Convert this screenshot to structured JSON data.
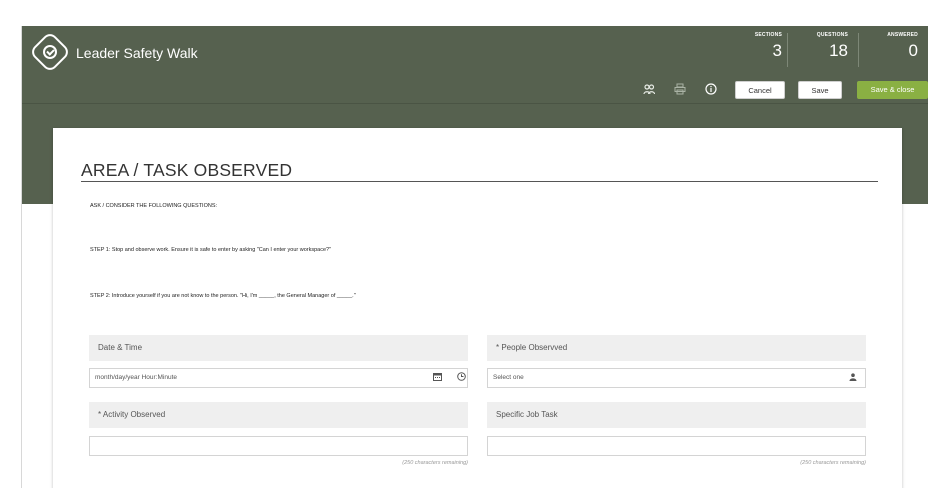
{
  "app": {
    "title": "Leader Safety Walk"
  },
  "stats": [
    {
      "label": "SECTIONS",
      "value": "3"
    },
    {
      "label": "QUESTIONS",
      "value": "18"
    },
    {
      "label": "ANSWERED",
      "value": "0"
    }
  ],
  "toolbar": {
    "cancel_label": "Cancel",
    "save_label": "Save",
    "save_close_label": "Save & close"
  },
  "section": {
    "title": "AREA / TASK OBSERVED",
    "instructions": [
      "ASK / CONSIDER THE FOLLOWING QUESTIONS:",
      "STEP 1:  Stop and observe work.  Ensure it is safe to enter by asking \"Can I enter your workspace?\"",
      "STEP 2: Introduce yourself if you are not know to the person. \"Hi, I'm _____, the General Manager of _____.\""
    ]
  },
  "fields": {
    "date_time": {
      "label": "Date & Time",
      "placeholder": "month/day/year Hour:Minute"
    },
    "people_observed": {
      "label": "* People Observved",
      "value": "Select one"
    },
    "activity_observed": {
      "label": "* Activity Observed",
      "hint": "(250 characters remaining)"
    },
    "specific_job_task": {
      "label": "Specific Job Task",
      "hint": "(250 characters remaining)"
    }
  },
  "colors": {
    "header_bg": "#56614f",
    "accent_green": "#8ab043"
  },
  "icons": {
    "logo": "search-check-icon",
    "people": "people-icon",
    "print": "print-icon",
    "info": "info-icon",
    "calendar": "calendar-icon",
    "clock": "clock-icon",
    "person": "person-icon"
  }
}
